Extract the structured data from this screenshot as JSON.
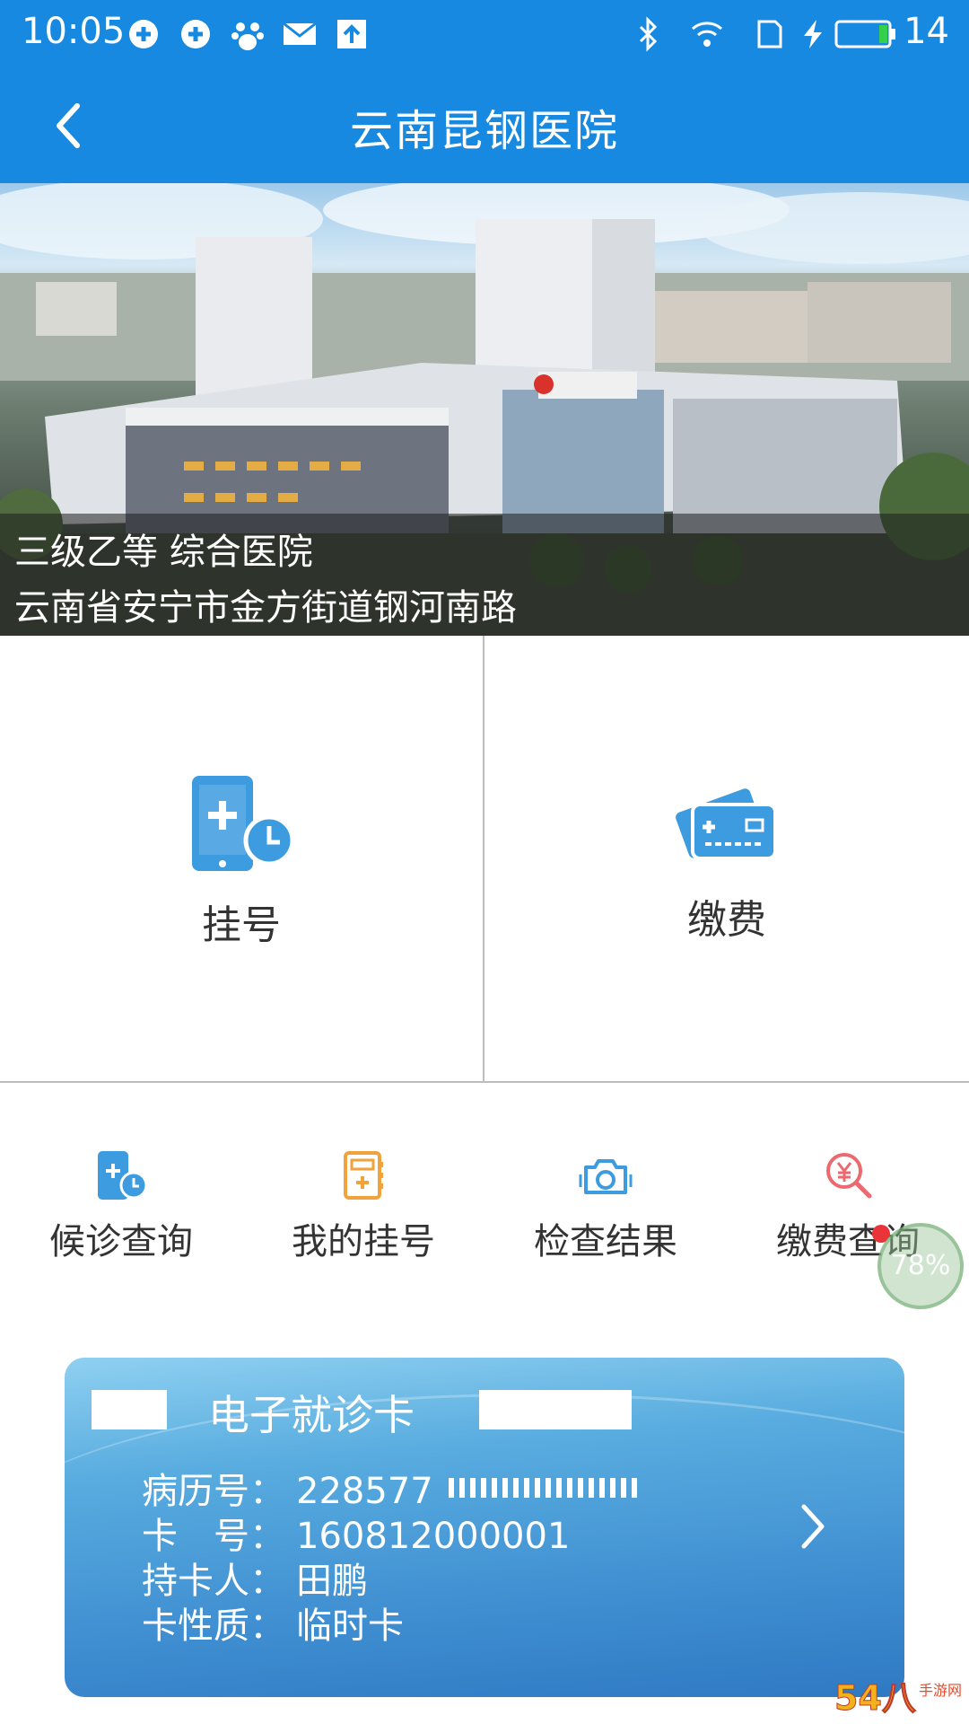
{
  "status_bar": {
    "time": "10:05",
    "battery": "14",
    "icons": [
      "app-icon",
      "app-icon",
      "baidu-icon",
      "mail-icon",
      "upload-icon",
      "bluetooth-icon",
      "wifi-icon",
      "sim-icon",
      "charging-icon",
      "battery-icon"
    ]
  },
  "header": {
    "title": "云南昆钢医院",
    "back_icon": "back-arrow-icon"
  },
  "banner": {
    "line1": "三级乙等 综合医院",
    "line2": "云南省安宁市金方街道钢河南路"
  },
  "tiles": [
    {
      "label": "挂号",
      "icon": "phone-plus-clock-icon"
    },
    {
      "label": "缴费",
      "icon": "cards-icon"
    }
  ],
  "quick_actions": [
    {
      "label": "候诊查询",
      "icon": "phone-clock-icon"
    },
    {
      "label": "我的挂号",
      "icon": "registration-book-icon"
    },
    {
      "label": "检查结果",
      "icon": "camera-icon"
    },
    {
      "label": "缴费查询",
      "icon": "yen-search-icon"
    }
  ],
  "floating": {
    "percent": "78%"
  },
  "card": {
    "title": "电子就诊卡",
    "rows": [
      {
        "key": "病历号：",
        "value": "228577"
      },
      {
        "key": "卡　号：",
        "value": "160812000001"
      },
      {
        "key": "持卡人：",
        "value": "田鹏"
      },
      {
        "key": "卡性质：",
        "value": "临时卡"
      }
    ]
  },
  "colors": {
    "primary": "#1789e0",
    "icon_blue": "#3d9be0",
    "icon_orange": "#f2a23a",
    "icon_red": "#e9343a",
    "divider": "#bdbdbd"
  },
  "watermark": {
    "text_main": "54八",
    "text_sub": "手游网"
  }
}
